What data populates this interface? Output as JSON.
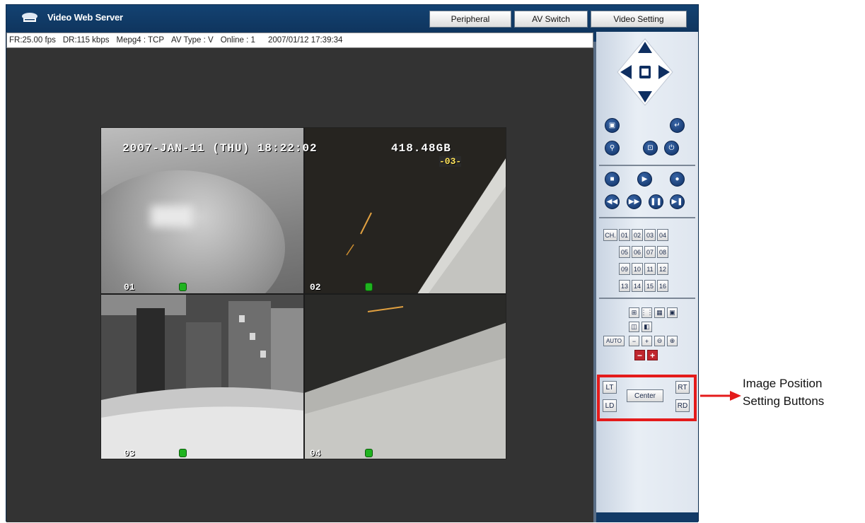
{
  "header": {
    "app_title": "Video Web Server",
    "buttons": [
      "Peripheral",
      "AV Switch",
      "Video Setting"
    ]
  },
  "status": {
    "fr": "FR:25.00 fps",
    "dr": "DR:115 kbps",
    "codec": "Mepg4 : TCP",
    "av_type": "AV Type : V",
    "online": "Online : 1",
    "datetime": "2007/01/12 17:39:34"
  },
  "video": {
    "timestamp": "2007-JAN-11 (THU) 18:22:02",
    "counter": "418.48GB",
    "counter_sub": "-03-",
    "channels": [
      "01",
      "02",
      "03",
      "04"
    ]
  },
  "controls": {
    "ch_label": "CH.",
    "channels": [
      "01",
      "02",
      "03",
      "04",
      "05",
      "06",
      "07",
      "08",
      "09",
      "10",
      "11",
      "12",
      "13",
      "14",
      "15",
      "16"
    ],
    "auto_label": "AUTO",
    "position": {
      "lt": "LT",
      "ld": "LD",
      "center": "Center",
      "rt": "RT",
      "rd": "RD"
    }
  },
  "annotation": {
    "line1": "Image Position",
    "line2": "Setting Buttons"
  },
  "colors": {
    "frame_bg": "#123a66",
    "highlight_red": "#e41b1b",
    "indicator_green": "#1fb31f"
  }
}
